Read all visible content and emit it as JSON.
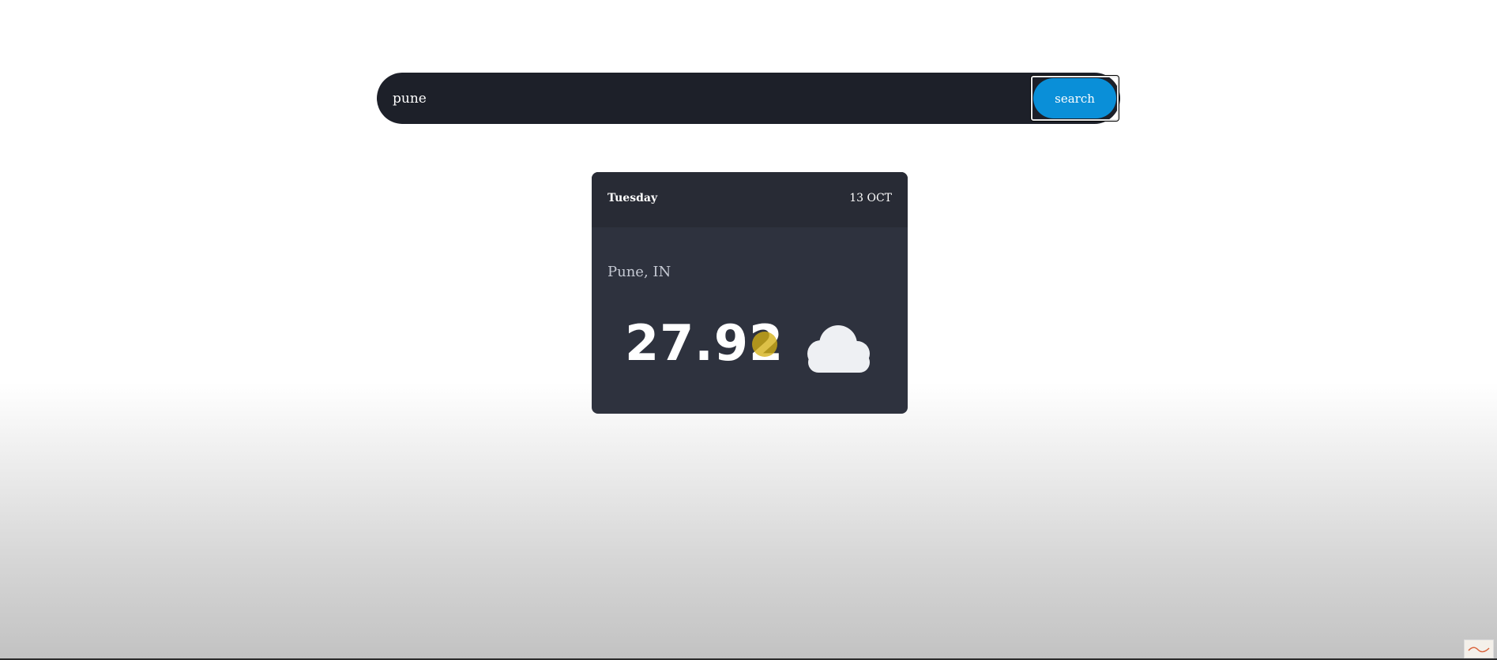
{
  "search": {
    "value": "pune",
    "button_label": "search"
  },
  "weather": {
    "day": "Tuesday",
    "date": "13 OCT",
    "location": "Pune, IN",
    "temperature": "27.92",
    "icon": "cloud-icon"
  },
  "colors": {
    "search_bg": "#1d2029",
    "button_bg": "#0a8fd8",
    "card_bg": "#2e323e",
    "card_header_bg": "#282b35"
  }
}
